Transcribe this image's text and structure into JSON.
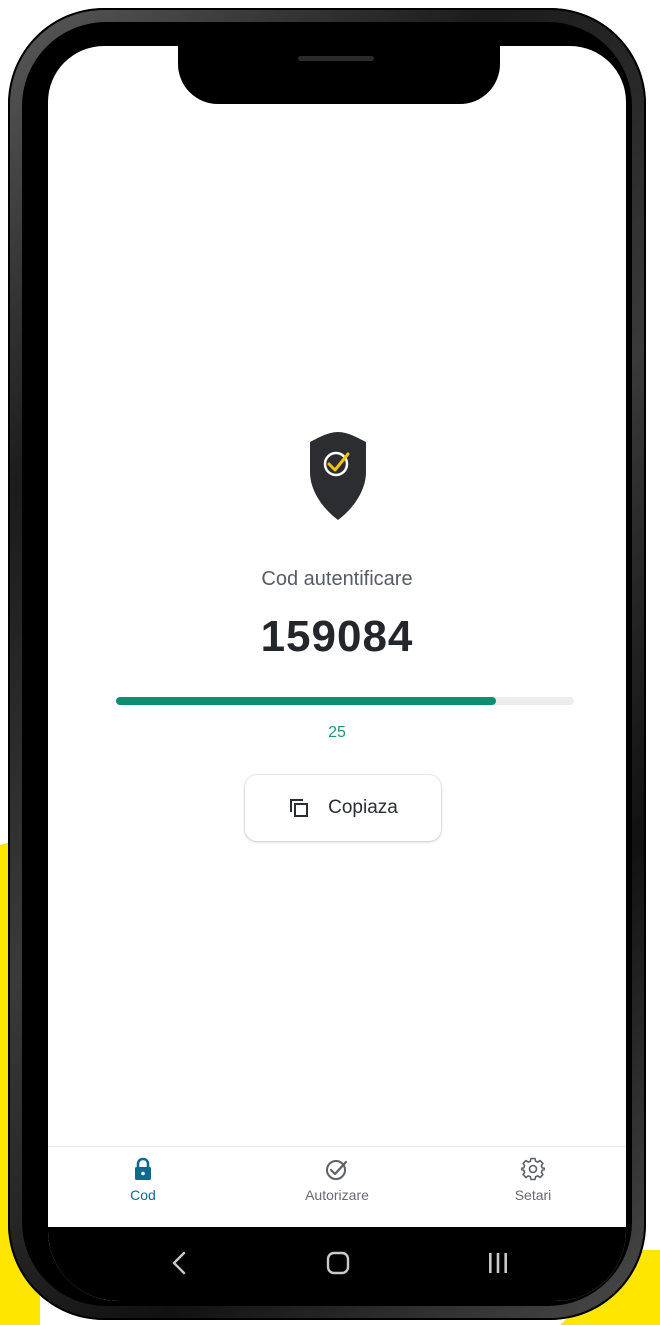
{
  "auth": {
    "label": "Cod autentificare",
    "code": "159084",
    "countdown": "25",
    "progress": 0.83
  },
  "copy_button": {
    "label": "Copiaza"
  },
  "tabs": [
    {
      "label": "Cod",
      "icon": "lock-icon",
      "active": true
    },
    {
      "label": "Autorizare",
      "icon": "check-circle-icon",
      "active": false
    },
    {
      "label": "Setari",
      "icon": "gear-icon",
      "active": false
    }
  ],
  "colors": {
    "accent_yellow": "#ffe600",
    "progress_green": "#0a8f70",
    "active_tab": "#0d6a8f",
    "shield_dark": "#2b2d30"
  }
}
